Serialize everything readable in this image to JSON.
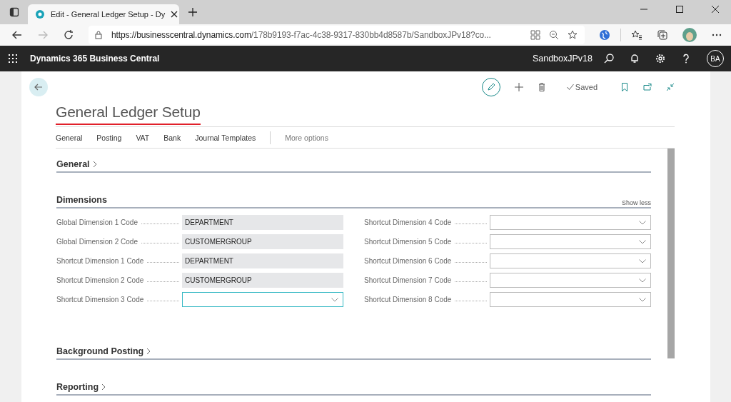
{
  "browser": {
    "tab_title": "Edit - General Ledger Setup - Dy",
    "url_host": "https://businesscentral.dynamics.com",
    "url_path": "/178b9193-f7ac-4c38-9317-830bb4d8587b/SandboxJPv18?co..."
  },
  "app_bar": {
    "title": "Dynamics 365 Business Central",
    "environment": "SandboxJPv18",
    "avatar": "BA"
  },
  "page": {
    "status": "Saved",
    "title": "General Ledger Setup",
    "nav": [
      {
        "label": "General",
        "kind": "tab"
      },
      {
        "label": "Posting",
        "kind": "tab"
      },
      {
        "label": "VAT",
        "kind": "tab"
      },
      {
        "label": "Bank",
        "kind": "tab"
      },
      {
        "label": "Journal Templates",
        "kind": "tab"
      },
      {
        "label": "More options",
        "kind": "more"
      }
    ],
    "sections": [
      {
        "title": "General",
        "expanded": false
      },
      {
        "title": "Dimensions",
        "expanded": true,
        "toggle": "Show less",
        "columns": [
          [
            {
              "label": "Global Dimension 1 Code",
              "kind": "readonly",
              "value": "DEPARTMENT",
              "focused": false
            },
            {
              "label": "Global Dimension 2 Code",
              "kind": "readonly",
              "value": "CUSTOMERGROUP",
              "focused": false
            },
            {
              "label": "Shortcut Dimension 1 Code",
              "kind": "readonly",
              "value": "DEPARTMENT",
              "focused": false
            },
            {
              "label": "Shortcut Dimension 2 Code",
              "kind": "readonly",
              "value": "CUSTOMERGROUP",
              "focused": false
            },
            {
              "label": "Shortcut Dimension 3 Code",
              "kind": "lookup",
              "focused": true
            }
          ],
          [
            {
              "label": "Shortcut Dimension 4 Code",
              "kind": "lookup",
              "focused": false
            },
            {
              "label": "Shortcut Dimension 5 Code",
              "kind": "lookup",
              "focused": false
            },
            {
              "label": "Shortcut Dimension 6 Code",
              "kind": "lookup",
              "focused": false
            },
            {
              "label": "Shortcut Dimension 7 Code",
              "kind": "lookup",
              "focused": false
            },
            {
              "label": "Shortcut Dimension 8 Code",
              "kind": "lookup",
              "focused": false
            }
          ]
        ]
      },
      {
        "title": "Background Posting",
        "expanded": false
      },
      {
        "title": "Reporting",
        "expanded": false
      }
    ]
  }
}
